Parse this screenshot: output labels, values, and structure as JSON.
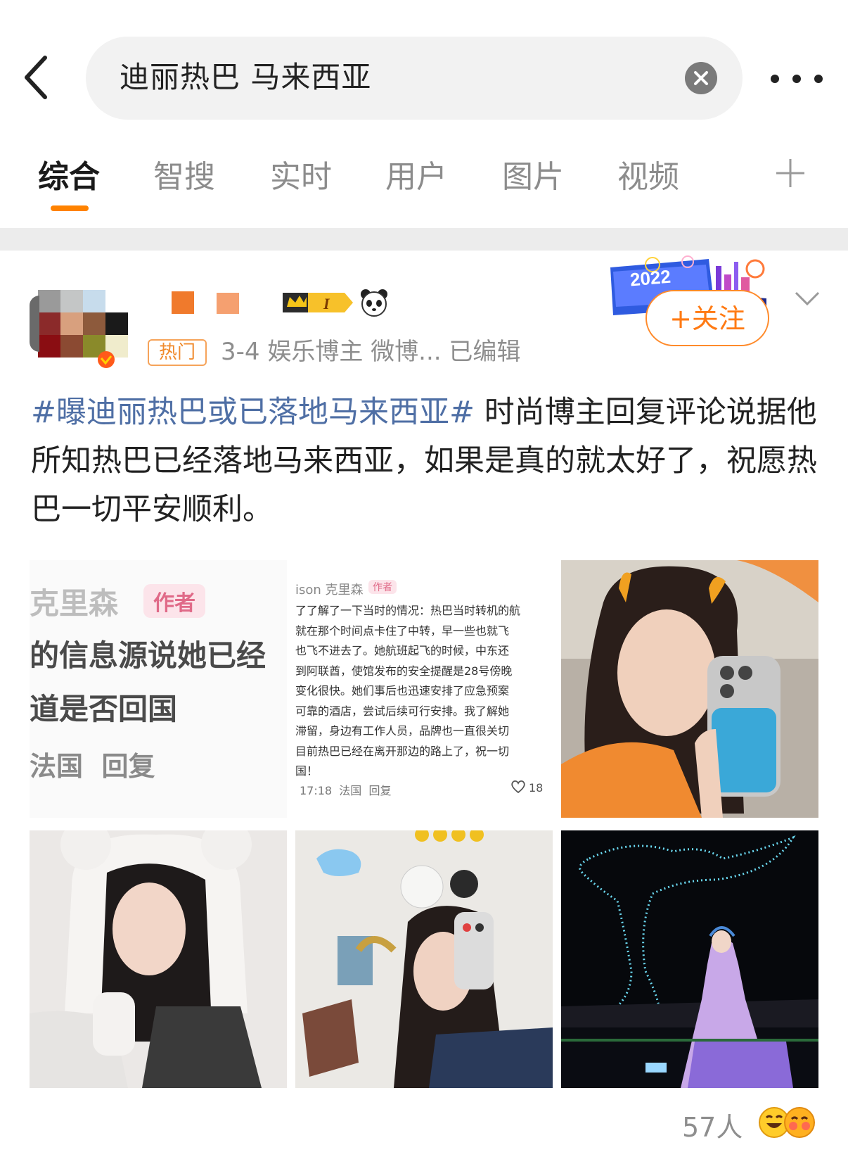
{
  "search": {
    "query": "迪丽热巴 马来西亚"
  },
  "tabs": [
    {
      "label": "综合",
      "active": true
    },
    {
      "label": "智搜"
    },
    {
      "label": "实时"
    },
    {
      "label": "用户"
    },
    {
      "label": "图片"
    },
    {
      "label": "视频"
    }
  ],
  "accent_color": "#ff8200",
  "post": {
    "hot_tag": "热门",
    "meta": "3-4  娱乐博主 微博...  已编辑",
    "follow_label": "+关注",
    "badge_text": "2022",
    "hashtag": "#曝迪丽热巴或已落地马来西亚#",
    "body": " 时尚博主回复评论说据他所知热巴已经落地马来西亚，如果是真的就太好了，祝愿热巴一切平安顺利。"
  },
  "images": {
    "img1": {
      "name": "克里森",
      "tag": "作者",
      "line1": "的信息源说她已经",
      "line2": "道是否回国",
      "footer": "法国  回复"
    },
    "img2": {
      "name": "ison 克里森",
      "tag": "作者",
      "lines": [
        "了了解了一下当时的情况：热巴当时转机的航",
        "就在那个时间点卡住了中转，早一些也就飞",
        "也飞不进去了。她航班起飞的时候，中东还",
        "到阿联酋，使馆发布的安全提醒是28号傍晚",
        "变化很快。她们事后也迅速安排了应急预案",
        "可靠的酒店，尝试后续可行安排。我了解她",
        "滞留，身边有工作人员，品牌也一直很关切",
        "目前热巴已经在离开那边的路上了，祝一切",
        "国！"
      ],
      "time": "17:18  法国  回复",
      "likes": "18"
    }
  },
  "footer": {
    "count": "57人"
  }
}
